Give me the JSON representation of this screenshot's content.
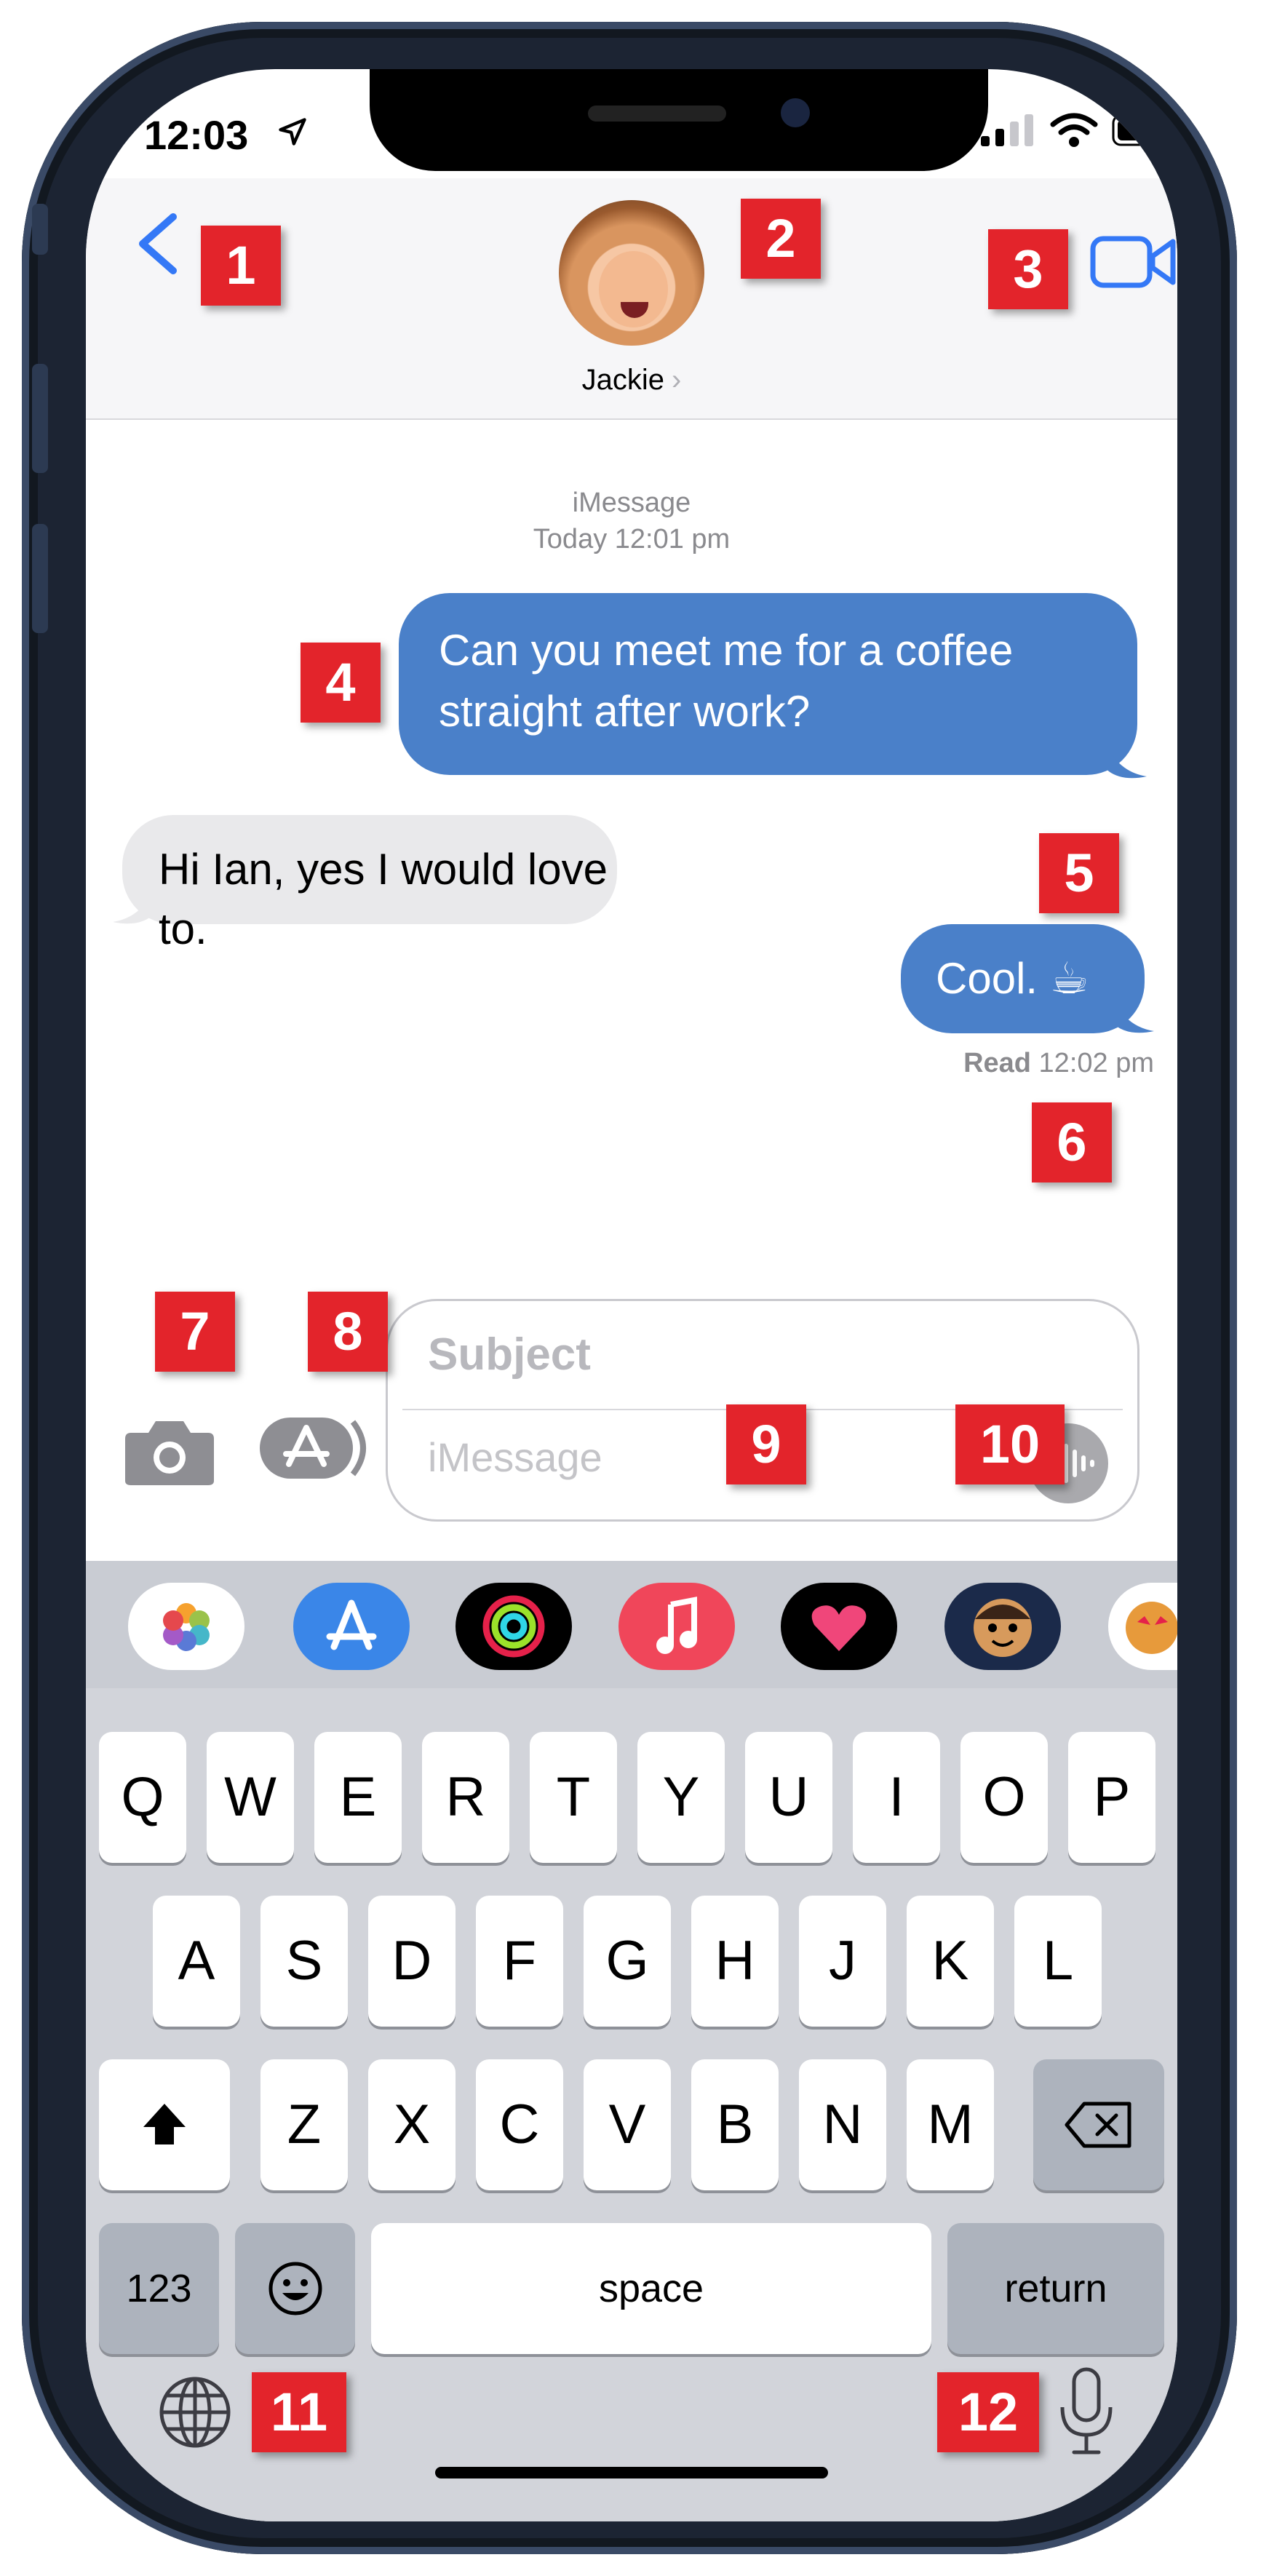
{
  "status_bar": {
    "time": "12:03"
  },
  "header": {
    "contact_name": "Jackie",
    "chevron": "›"
  },
  "conversation": {
    "service": "iMessage",
    "timestamp": "Today 12:01 pm",
    "messages": [
      {
        "direction": "outgoing",
        "line1": "Can you meet me for a coffee",
        "line2": "straight after work?"
      },
      {
        "direction": "incoming",
        "text": "Hi Ian, yes I would love to."
      },
      {
        "direction": "outgoing",
        "text": "Cool. ☕"
      }
    ],
    "read_label": "Read",
    "read_time": "12:02 pm"
  },
  "compose": {
    "subject_placeholder": "Subject",
    "message_placeholder": "iMessage"
  },
  "keyboard": {
    "row1": [
      "Q",
      "W",
      "E",
      "R",
      "T",
      "Y",
      "U",
      "I",
      "O",
      "P"
    ],
    "row2": [
      "A",
      "S",
      "D",
      "F",
      "G",
      "H",
      "J",
      "K",
      "L"
    ],
    "row3": [
      "Z",
      "X",
      "C",
      "V",
      "B",
      "N",
      "M"
    ],
    "numbers_key": "123",
    "space_key": "space",
    "return_key": "return"
  },
  "callouts": [
    "1",
    "2",
    "3",
    "4",
    "5",
    "6",
    "7",
    "8",
    "9",
    "10",
    "11",
    "12"
  ],
  "colors": {
    "ios_blue": "#3478f6",
    "bubble_blue": "#4a80c9",
    "callout_red": "#e3242b",
    "bubble_gray": "#e9e9eb"
  },
  "icons": [
    "location-arrow-icon",
    "signal-icon",
    "wifi-icon",
    "battery-icon",
    "back-chevron-icon",
    "video-camera-icon",
    "camera-icon",
    "app-store-icon",
    "audio-waveform-icon",
    "photos-app-icon",
    "app-store-app-icon",
    "activity-app-icon",
    "music-app-icon",
    "digital-touch-app-icon",
    "memoji-app-icon",
    "animoji-app-icon",
    "shift-icon",
    "backspace-icon",
    "emoji-icon",
    "globe-icon",
    "microphone-icon"
  ]
}
